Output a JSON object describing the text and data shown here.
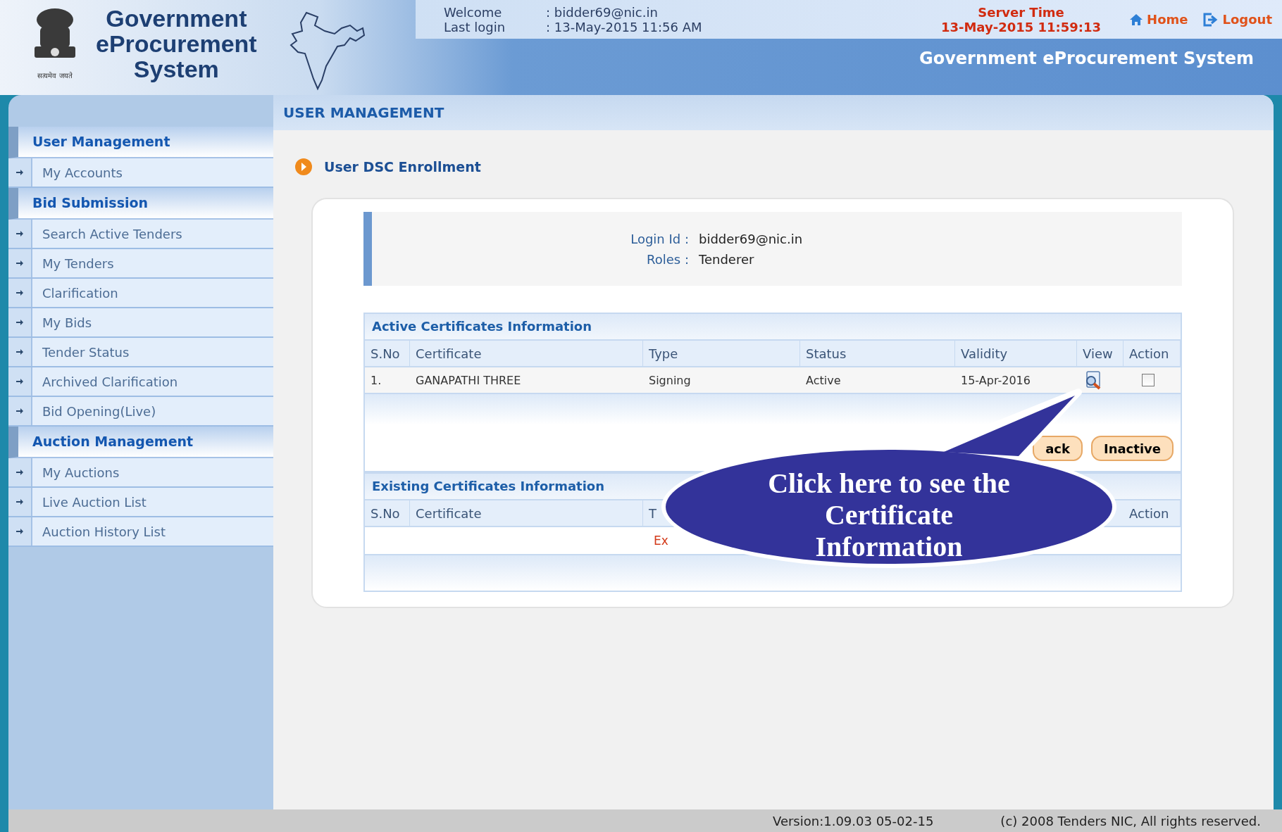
{
  "header": {
    "logo_lines": [
      "Government",
      "eProcurement",
      "System"
    ],
    "emblem_caption": "सत्यमेव जयते",
    "welcome_label": "Welcome",
    "welcome_value": ": bidder69@nic.in",
    "last_login_label": "Last login",
    "last_login_value": ": 13-May-2015 11:56 AM",
    "server_time_label": "Server Time",
    "server_time": "13-May-2015 11:59:13",
    "links": [
      {
        "label": "Home",
        "kind": "home"
      },
      {
        "label": "Logout",
        "kind": "logout"
      }
    ],
    "banner_title": "Government eProcurement System"
  },
  "sidebar": {
    "sections": [
      {
        "title": "User Management",
        "items": [
          "My Accounts"
        ]
      },
      {
        "title": "Bid Submission",
        "items": [
          "Search Active Tenders",
          "My Tenders",
          "Clarification",
          "My Bids",
          "Tender Status",
          "Archived Clarification",
          "Bid Opening(Live)"
        ]
      },
      {
        "title": "Auction Management",
        "items": [
          "My Auctions",
          "Live Auction List",
          "Auction History List"
        ]
      }
    ]
  },
  "page_title": "USER MANAGEMENT",
  "section_title": "User DSC Enrollment",
  "user_info": [
    {
      "label": "Login Id :",
      "value": "bidder69@nic.in"
    },
    {
      "label": "Roles :",
      "value": "Tenderer"
    }
  ],
  "active_certificates": {
    "title": "Active Certificates Information",
    "columns": [
      "S.No",
      "Certificate",
      "Type",
      "Status",
      "Validity",
      "View",
      "Action"
    ],
    "rows": [
      {
        "sno": "1.",
        "certificate": "GANAPATHI THREE",
        "type": "Signing",
        "status": "Active",
        "validity": "15-Apr-2016",
        "checked": false
      }
    ]
  },
  "buttons": [
    {
      "label": "ack"
    },
    {
      "label": "Inactive"
    }
  ],
  "existing_certificates": {
    "title": "Existing Certificates Information",
    "columns": [
      "S.No",
      "Certificate",
      "T",
      "Action"
    ],
    "message": "Ex"
  },
  "callout": {
    "text": "Click here to see the Certificate Information"
  },
  "footer": {
    "version": "Version:1.09.03 05-02-15",
    "copyright": "(c) 2008 Tenders NIC, All rights reserved."
  }
}
